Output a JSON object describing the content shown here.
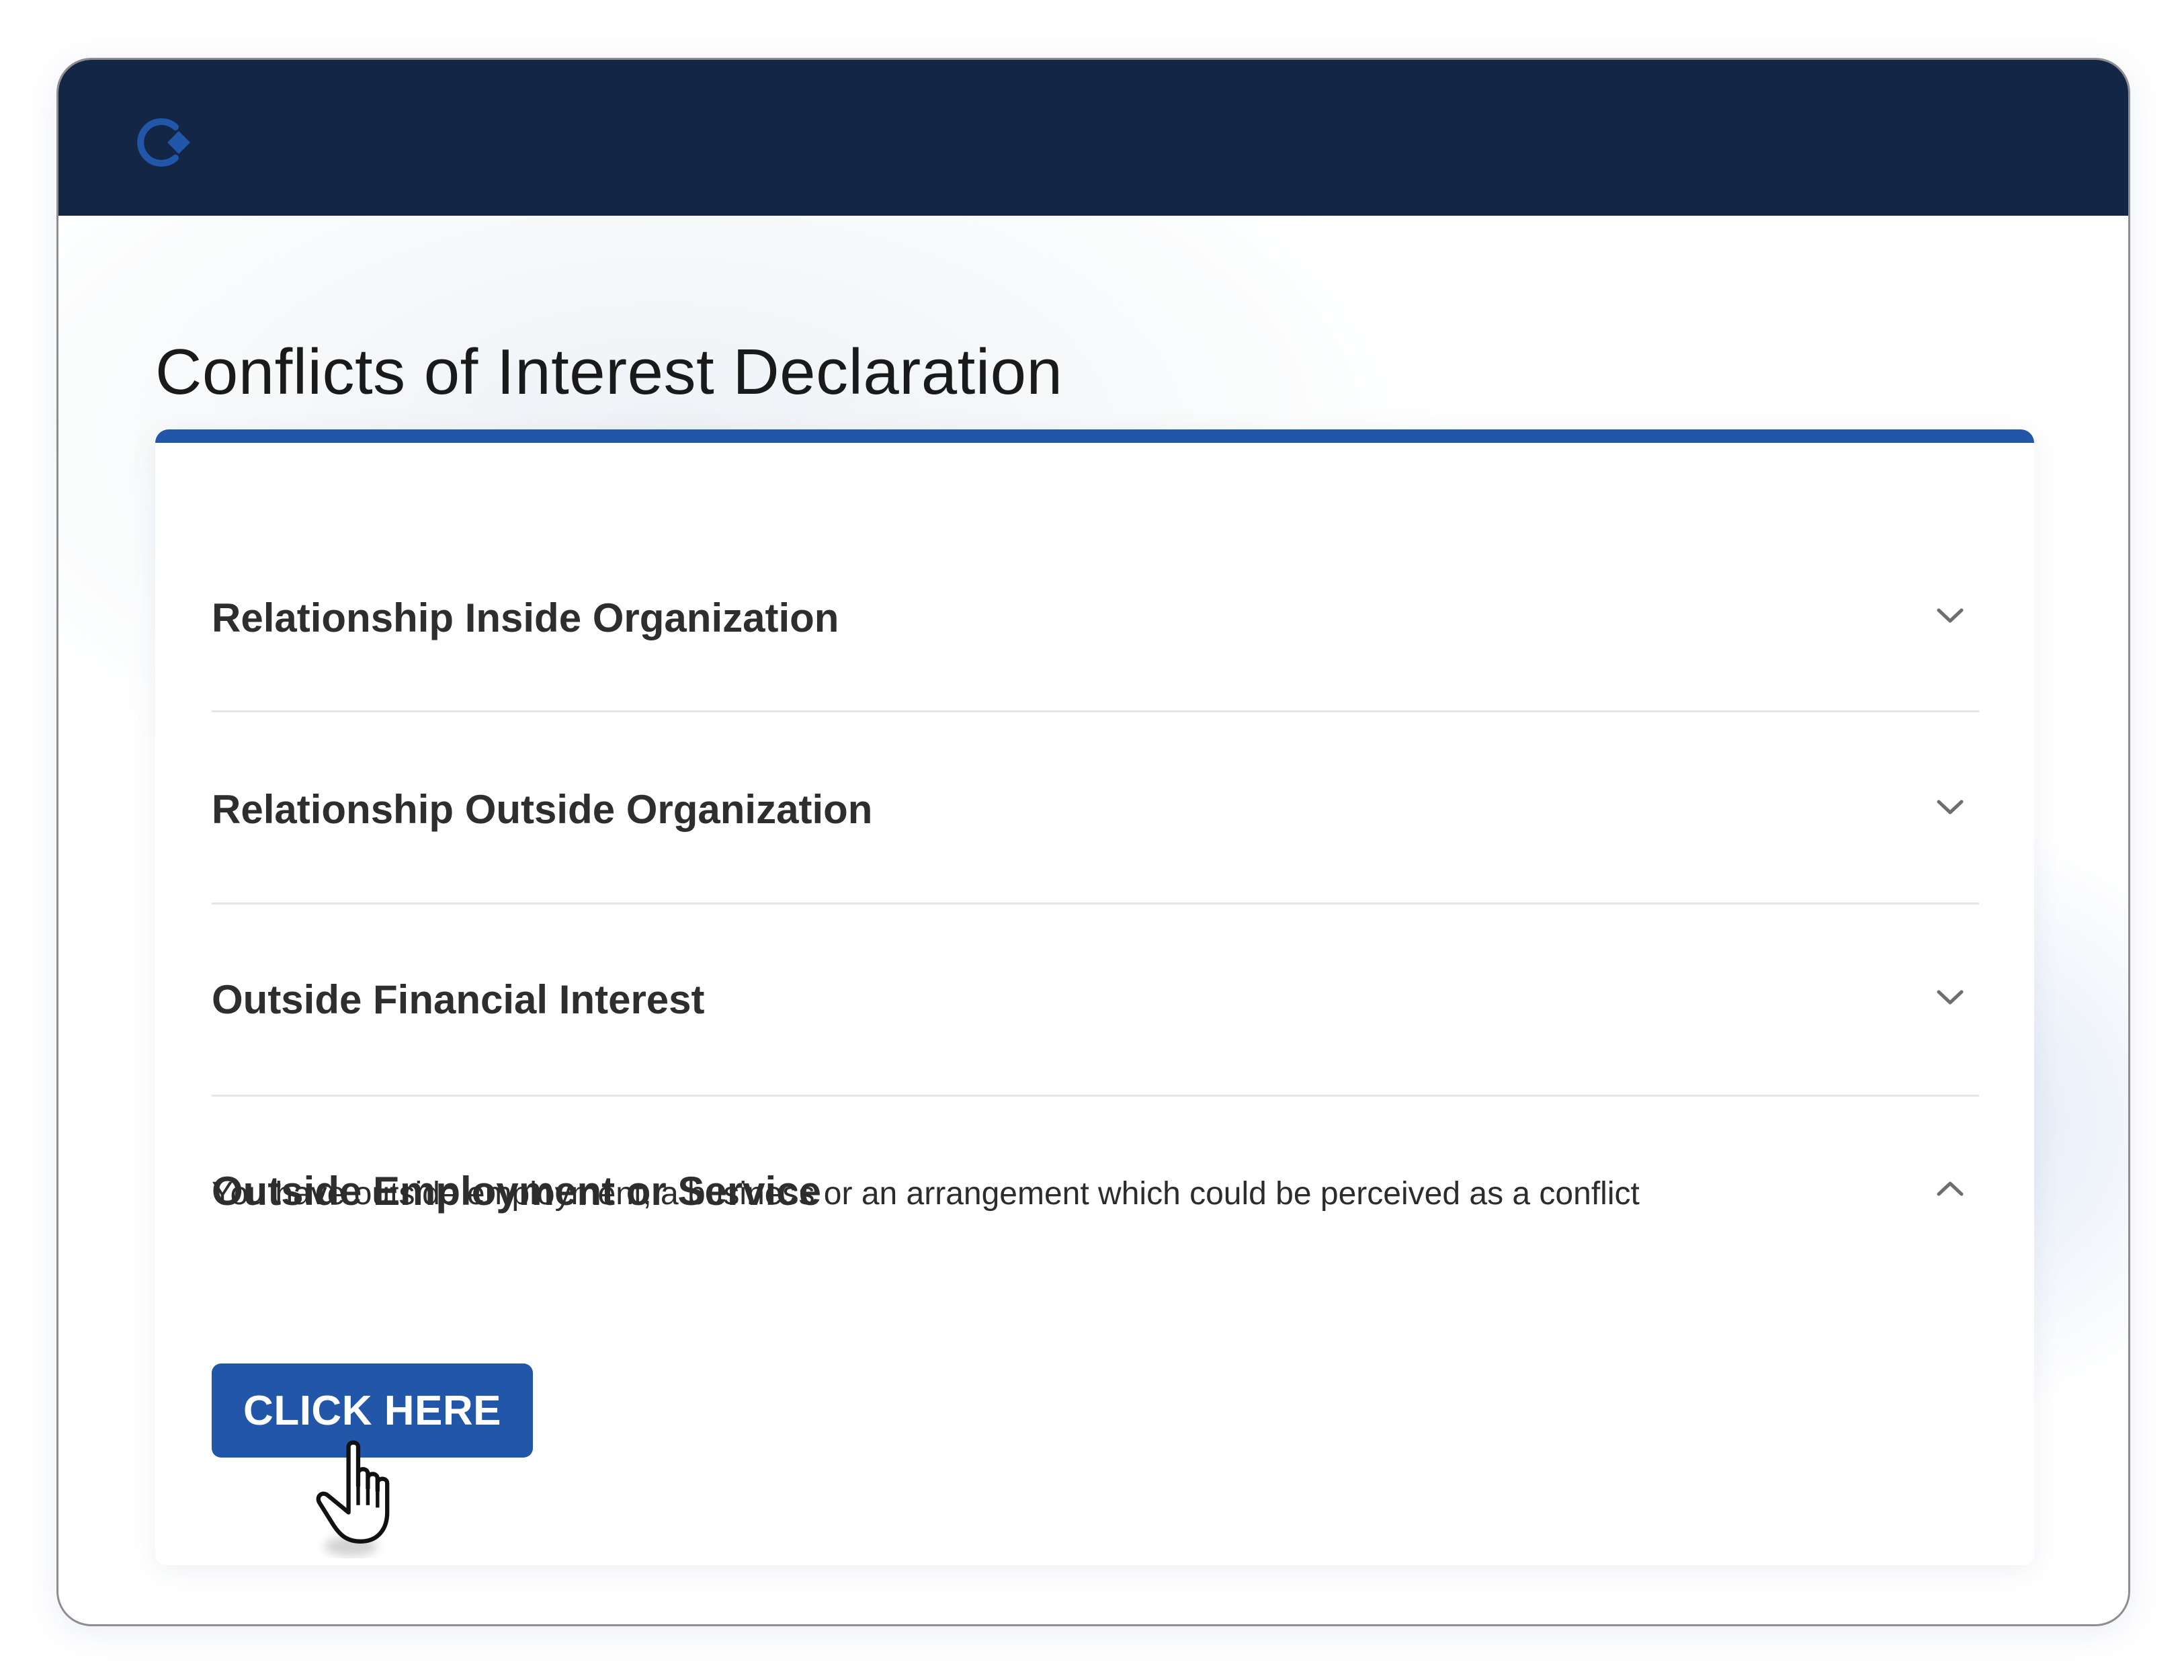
{
  "header": {
    "logo_icon": "app-logo-icon",
    "colors": {
      "background": "#132645",
      "logo": "#2156a8"
    }
  },
  "page": {
    "title": "Conflicts of Interest Declaration",
    "accent_color": "#2156a8"
  },
  "accordion": {
    "items": [
      {
        "title": "Relationship Inside Organization",
        "expanded": false,
        "icon": "chevron-down-icon"
      },
      {
        "title": "Relationship Outside Organization",
        "expanded": false,
        "icon": "chevron-down-icon"
      },
      {
        "title": "Outside Financial Interest",
        "expanded": false,
        "icon": "chevron-down-icon"
      },
      {
        "title": "Outside Employment or Service",
        "expanded": true,
        "icon": "chevron-up-icon",
        "description": "You have outside employment, a business or an arrangement which could be perceived as a conflict",
        "button_label": "CLICK HERE"
      }
    ]
  },
  "cursor": {
    "icon": "hand-pointer-icon"
  }
}
